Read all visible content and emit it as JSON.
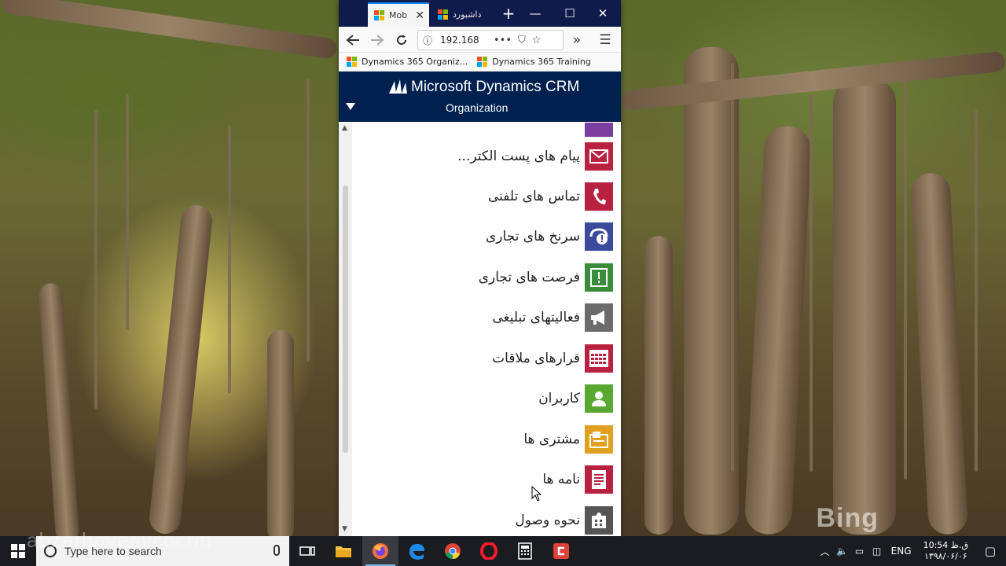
{
  "browser": {
    "tabs": [
      {
        "label": "Mob"
      },
      {
        "label": "داشبورد"
      }
    ],
    "url": "192.168",
    "bookmarks": [
      {
        "label": "Dynamics 365 Organiz..."
      },
      {
        "label": "Dynamics 365 Training"
      }
    ]
  },
  "crm": {
    "title": "Microsoft Dynamics CRM",
    "subtitle": "Organization"
  },
  "nav_items": [
    {
      "label": "پیام های پست الکتر...",
      "icon": "email-icon",
      "color": "#b8213f"
    },
    {
      "label": "تماس های تلفنی",
      "icon": "phone-icon",
      "color": "#b8213f"
    },
    {
      "label": "سرنخ های تجاری",
      "icon": "lead-icon",
      "color": "#3b4b9c"
    },
    {
      "label": "فرصت های تجاری",
      "icon": "opportunity-icon",
      "color": "#3a8b3a"
    },
    {
      "label": "فعالیتهای تبلیغی",
      "icon": "megaphone-icon",
      "color": "#6b6b6b"
    },
    {
      "label": "قرارهای ملاقات",
      "icon": "calendar-icon",
      "color": "#b8213f"
    },
    {
      "label": "کاربران",
      "icon": "user-icon",
      "color": "#5aa832"
    },
    {
      "label": "مشتری ها",
      "icon": "customer-icon",
      "color": "#e0a020"
    },
    {
      "label": "نامه ها",
      "icon": "letter-icon",
      "color": "#b8213f"
    },
    {
      "label": "نحوه وصول",
      "icon": "puzzle-icon",
      "color": "#555555"
    }
  ],
  "taskbar": {
    "search_placeholder": "Type here to search",
    "language": "ENG",
    "time": "ق.ظ 10:54",
    "date": "۱۳۹۸/۰۶/۰۶"
  },
  "wallpaper": {
    "brand": "Bing"
  },
  "watermark": "abzarhayeaycocrm"
}
